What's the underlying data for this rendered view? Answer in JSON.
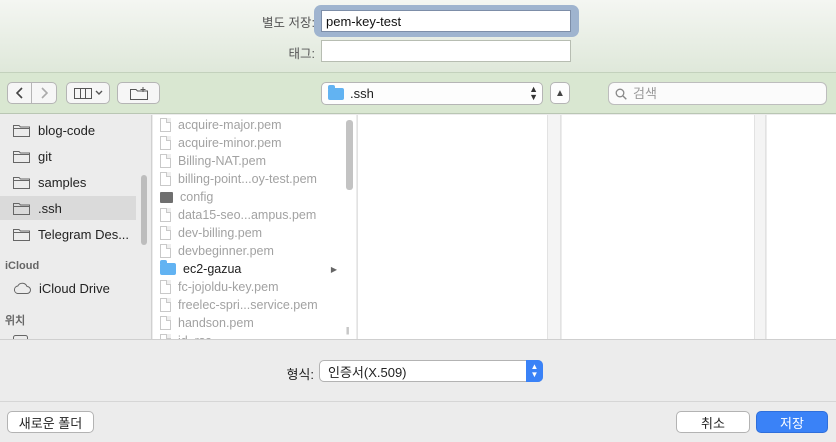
{
  "header": {
    "save_as_label": "별도 저장:",
    "filename_value": "pem-key-test",
    "tags_label": "태그:",
    "tags_value": ""
  },
  "toolbar": {
    "location": ".ssh",
    "search_placeholder": "검색"
  },
  "sidebar": {
    "items": [
      {
        "label": "blog-code",
        "icon": "folder-icon"
      },
      {
        "label": "git",
        "icon": "folder-icon"
      },
      {
        "label": "samples",
        "icon": "folder-icon"
      },
      {
        "label": ".ssh",
        "icon": "folder-icon",
        "selected": true
      },
      {
        "label": "Telegram Des...",
        "icon": "folder-icon"
      }
    ],
    "icloud_heading": "iCloud",
    "icloud_items": [
      {
        "label": "iCloud Drive",
        "icon": "cloud-icon"
      }
    ],
    "location_heading": "위치"
  },
  "files": [
    {
      "name": "acquire-major.pem",
      "type": "document",
      "enabled": false
    },
    {
      "name": "acquire-minor.pem",
      "type": "document",
      "enabled": false
    },
    {
      "name": "Billing-NAT.pem",
      "type": "document",
      "enabled": false
    },
    {
      "name": "billing-point...oy-test.pem",
      "type": "document",
      "enabled": false
    },
    {
      "name": "config",
      "type": "executable",
      "enabled": false
    },
    {
      "name": "data15-seo...ampus.pem",
      "type": "document",
      "enabled": false
    },
    {
      "name": "dev-billing.pem",
      "type": "document",
      "enabled": false
    },
    {
      "name": "devbeginner.pem",
      "type": "document",
      "enabled": false
    },
    {
      "name": "ec2-gazua",
      "type": "folder",
      "enabled": true
    },
    {
      "name": "fc-jojoldu-key.pem",
      "type": "document",
      "enabled": false
    },
    {
      "name": "freelec-spri...service.pem",
      "type": "document",
      "enabled": false
    },
    {
      "name": "handson.pem",
      "type": "document",
      "enabled": false
    },
    {
      "name": "id_rsa",
      "type": "document",
      "enabled": false
    }
  ],
  "bottom": {
    "format_label": "형식:",
    "format_value": "인증서(X.509)",
    "new_folder_label": "새로운 폴더",
    "cancel_label": "취소",
    "save_label": "저장"
  },
  "colors": {
    "accent": "#3a82f7",
    "toolbar_bg": "#d9e7d1",
    "folder": "#62b3f2"
  }
}
